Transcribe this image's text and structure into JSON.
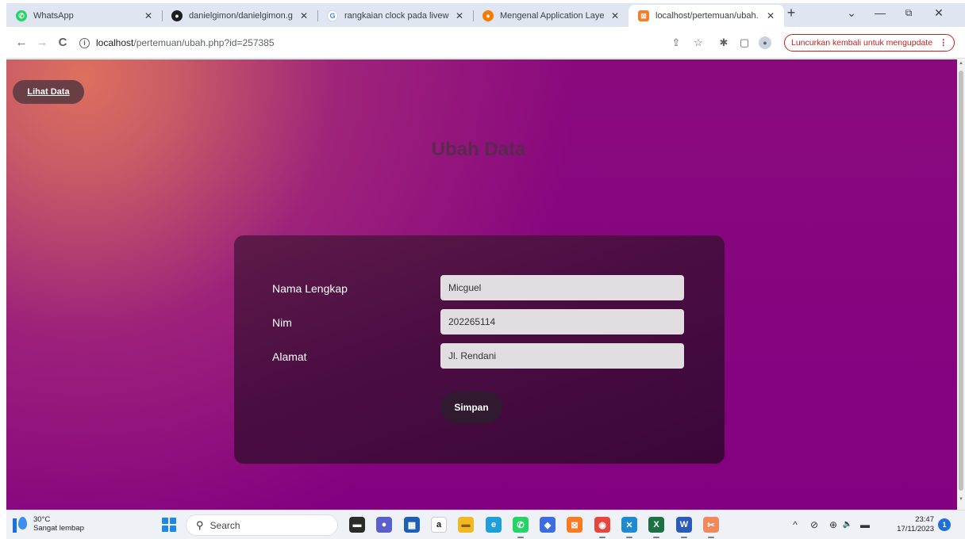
{
  "browser": {
    "tabs": [
      {
        "title": "WhatsApp",
        "icon": "whatsapp-icon",
        "color": "#25d366",
        "glyph": "✆"
      },
      {
        "title": "danielgimon/danielgimon.g",
        "icon": "github-icon",
        "color": "#1b1f23",
        "glyph": "●"
      },
      {
        "title": "rangkaian clock pada livewi",
        "icon": "google-icon",
        "color": "#4285f4",
        "glyph": "G"
      },
      {
        "title": "Mengenal Application Laye",
        "icon": "site-icon",
        "color": "#f57c00",
        "glyph": "●"
      },
      {
        "title": "localhost/pertemuan/ubah.",
        "icon": "xampp-icon",
        "color": "#fb7a24",
        "glyph": "⊠"
      }
    ],
    "new_tab_label": "+",
    "tab_close_glyph": "✕",
    "window_controls": {
      "list": "⌄",
      "minimize": "—",
      "restore": "⧉",
      "close": "✕"
    },
    "nav": {
      "back": "←",
      "forward": "→",
      "reload": "C"
    },
    "url_prefix": "localhost",
    "url_path": "/pertemuan/ubah.php?id=257385",
    "toolbar_icons": {
      "share": "⇪",
      "bookmark": "☆",
      "extensions": "✱",
      "sidepanel": "▢",
      "profile": "●"
    },
    "update_button": "Luncurkan kembali untuk mengupdate",
    "update_menu": "⋮"
  },
  "page": {
    "back_link": "Lihat Data",
    "title": "Ubah Data",
    "form": {
      "fields": [
        {
          "label": "Nama Lengkap",
          "value": "Micguel"
        },
        {
          "label": "Nim",
          "value": "202265114"
        },
        {
          "label": "Alamat",
          "value": "Jl. Rendani"
        }
      ],
      "submit_label": "Simpan"
    }
  },
  "taskbar": {
    "weather_temp": "30°C",
    "weather_desc": "Sangat lembap",
    "search_label": "Search",
    "apps": [
      {
        "name": "file-explorer-icon",
        "color": "#2b2b2b",
        "glyph": "▬"
      },
      {
        "name": "meet-icon",
        "color": "#5b5fc7",
        "glyph": "●"
      },
      {
        "name": "store-icon",
        "color": "#1f5fb3",
        "glyph": "▦"
      },
      {
        "name": "amazon-icon",
        "color": "#ffffff",
        "glyph": "a"
      },
      {
        "name": "folder-icon",
        "color": "#f2b824",
        "glyph": "▬"
      },
      {
        "name": "edge-icon",
        "color": "#1f9fd8",
        "glyph": "e"
      },
      {
        "name": "whatsapp-icon",
        "color": "#25d366",
        "glyph": "✆"
      },
      {
        "name": "office-icon",
        "color": "#3b6de0",
        "glyph": "◆"
      },
      {
        "name": "xampp-icon",
        "color": "#fb7a24",
        "glyph": "⊠"
      },
      {
        "name": "chrome-icon",
        "color": "#e8453c",
        "glyph": "◉"
      },
      {
        "name": "vscode-icon",
        "color": "#1f8ad2",
        "glyph": "✕"
      },
      {
        "name": "excel-icon",
        "color": "#1d7044",
        "glyph": "X"
      },
      {
        "name": "word-icon",
        "color": "#2b5bb8",
        "glyph": "W"
      },
      {
        "name": "snipping-icon",
        "color": "#f08a5d",
        "glyph": "✂"
      }
    ],
    "tray": {
      "chevron": "^",
      "network": "⊘",
      "language": "⊕",
      "volume": "🔈",
      "battery": "▬"
    },
    "time": "23:47",
    "date": "17/11/2023",
    "notification_count": "1"
  },
  "colors": {
    "page_background": "#820080",
    "card_background": "#4a0d42",
    "title_color": "#5a2a4e",
    "button_background": "#2f1a2f",
    "input_background": "#e2dde0",
    "update_accent": "#c5221f"
  }
}
